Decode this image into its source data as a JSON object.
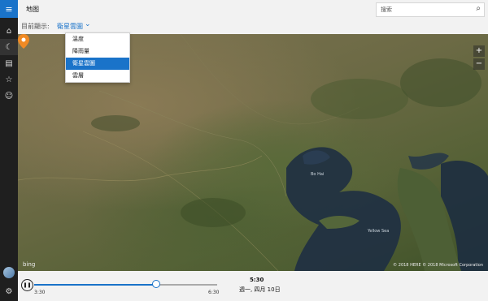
{
  "app": {
    "title": "地图"
  },
  "search": {
    "placeholder": "搜索",
    "icon": "search-icon"
  },
  "filter": {
    "label": "目前顯示:",
    "value": "衛星雲圖"
  },
  "dropdown": {
    "options": [
      "溫度",
      "降雨量",
      "衛星雲圖",
      "雲層"
    ],
    "selected_index": 2
  },
  "rail": {
    "icons": [
      "hamburger-icon",
      "home-icon",
      "moon-icon",
      "chart-icon",
      "star-icon",
      "smile-icon",
      "avatar",
      "gear-icon"
    ]
  },
  "map": {
    "zoom_in": "+",
    "zoom_out": "−",
    "bing_logo": "bing",
    "copyright": "© 2018 HERE © 2018 Microsoft Corporation",
    "sea_labels": [
      "Bo Hai",
      "Yellow Sea"
    ]
  },
  "timeline": {
    "start": "3:30",
    "end": "6:30",
    "current_time": "5:30",
    "current_date": "週一, 四月 10日",
    "progress": 0.66
  },
  "colors": {
    "accent": "#1a73c9",
    "rail": "#1f1f1f"
  }
}
